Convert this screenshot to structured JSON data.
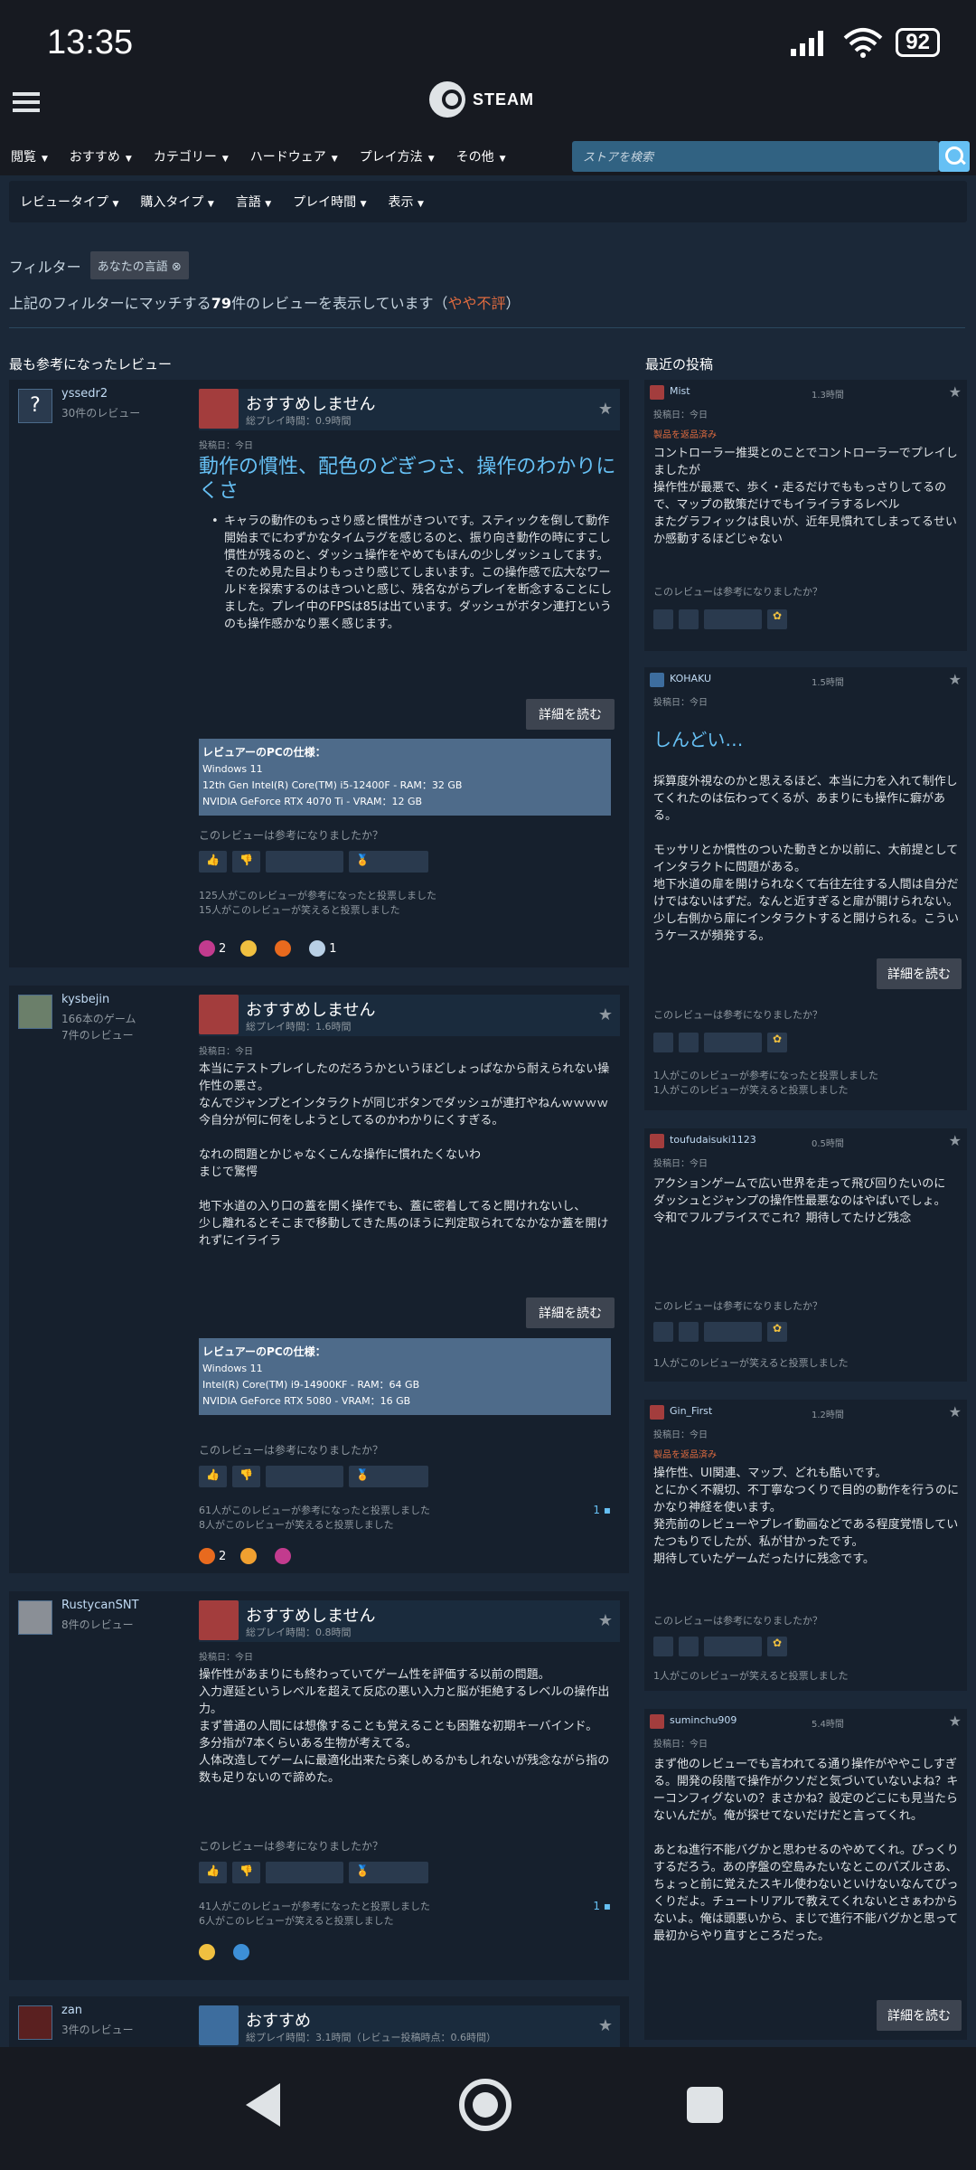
{
  "status": {
    "time": "13:35",
    "battery": "92"
  },
  "header": {
    "logo_text": "STEAM"
  },
  "nav": {
    "items": [
      "閲覧",
      "おすすめ",
      "カテゴリー",
      "ハードウェア",
      "プレイ方法",
      "その他"
    ],
    "search_placeholder": "ストアを検索"
  },
  "subnav": {
    "items": [
      "レビュータイプ",
      "購入タイプ",
      "言語",
      "プレイ時間",
      "表示"
    ]
  },
  "filter": {
    "label": "フィルター",
    "tag": "あなたの言語",
    "match_prefix": "上記のフィルターにマッチする",
    "match_count": "79",
    "match_suffix": "件のレビューを表示しています（",
    "rating": "やや不評",
    "match_close": "）"
  },
  "sections": {
    "helpful_title": "最も参考になったレビュー",
    "recent_title": "最近の投稿"
  },
  "common": {
    "not_recommended": "おすすめしません",
    "recommended": "おすすめ",
    "read_more": "詳細を読む",
    "helpful_q": "このレビューは参考になりましたか？",
    "pc_specs_title": "レビュアーのPCの仕様："
  },
  "reviews": [
    {
      "user": "yssedr2",
      "games": "",
      "count": "30件のレビュー",
      "hours": "総プレイ時間：0.9時間",
      "date": "投稿日：今日",
      "title": "動作の慣性、配色のどぎつさ、操作のわかりにくさ",
      "text": "キャラの動作のもっさり感と慣性がきついです。スティックを倒して動作開始までにわずかなタイムラグを感じるのと、振り向き動作の時にすこし慣性が残るのと、ダッシュ操作をやめてもほんの少しダッシュしてます。そのため見た目よりもっさり感じてしまいます。この操作感で広大なワールドを探索するのはきついと感じ、残名ながらプレイを断念することにしました。プレイ中のFPSは85は出ています。ダッシュがボタン連打というのも操作感かなり悪く感じます。",
      "specs": [
        "Windows 11",
        "12th Gen Intel(R) Core(TM) i5-12400F - RAM：32 GB",
        "NVIDIA GeForce RTX 4070 Ti - VRAM：12 GB"
      ],
      "stats": [
        "125人がこのレビューが参考になったと投票しました",
        "15人がこのレビューが笑えると投票しました"
      ],
      "awards": [
        "2",
        "",
        "",
        "1"
      ],
      "comments": ""
    },
    {
      "user": "kysbejin",
      "games": "166本のゲーム",
      "count": "7件のレビュー",
      "hours": "総プレイ時間：1.6時間",
      "date": "投稿日：今日",
      "title": "",
      "text": "本当にテストプレイしたのだろうかというほどしょっぱなから耐えられない操作性の悪さ。\nなんでジャンプとインタラクトが同じボタンでダッシュが連打やねんｗｗｗｗ\n今自分が何に何をしようとしてるのかわかりにくすぎる。\n\nなれの問題とかじゃなくこんな操作に慣れたくないわ\nまじで驚愕\n\n地下水道の入り口の蓋を開く操作でも、蓋に密着してると開けれないし、\n少し離れるとそこまで移動してきた馬のほうに判定取られてなかなか蓋を開けれずにイライラ",
      "specs": [
        "Windows 11",
        "Intel(R) Core(TM) i9-14900KF - RAM：64 GB",
        "NVIDIA GeForce RTX 5080 - VRAM：16 GB"
      ],
      "stats": [
        "61人がこのレビューが参考になったと投票しました",
        "8人がこのレビューが笑えると投票しました"
      ],
      "awards": [
        "2",
        "",
        ""
      ],
      "comments": "1"
    },
    {
      "user": "RustycanSNT",
      "games": "",
      "count": "8件のレビュー",
      "hours": "総プレイ時間：0.8時間",
      "date": "投稿日：今日",
      "title": "",
      "text": "操作性があまりにも終わっていてゲーム性を評価する以前の問題。\n入力遅延というレベルを超えて反応の悪い入力と脳が拒絶するレベルの操作出力。\nまず普通の人間には想像することも覚えることも困難な初期キーバインド。\n多分指が7本くらいある生物が考えてる。\n人体改造してゲームに最適化出来たら楽しめるかもしれないが残念ながら指の数も足りないので諦めた。",
      "specs": [],
      "stats": [
        "41人がこのレビューが参考になったと投票しました",
        "6人がこのレビューが笑えると投票しました"
      ],
      "awards": [
        "",
        ""
      ],
      "comments": "1"
    },
    {
      "user": "zan",
      "games": "",
      "count": "3件のレビュー",
      "hours": "総プレイ時間：3.1時間（レビュー投稿時点：0.6時間）",
      "date": "",
      "title": "",
      "text": "",
      "specs": [],
      "stats": [],
      "awards": [],
      "comments": ""
    }
  ],
  "recent": [
    {
      "user": "Mist",
      "hours": "1.3時間",
      "date": "投稿日：今日",
      "refund": "製品を返品済み",
      "title": "",
      "text": "コントローラー推奨とのことでコントローラーでプレイしましたが\n操作性が最悪で、歩く・走るだけでももっさりしてるので、マップの散策だけでもイライラするレベル\nまたグラフィックは良いが、近年見慣れてしまってるせいか感動するほどじゃない",
      "stats": []
    },
    {
      "user": "KOHAKU",
      "hours": "1.5時間",
      "date": "投稿日：今日",
      "refund": "",
      "title": "しんどい…",
      "text": "採算度外視なのかと思えるほど、本当に力を入れて制作してくれたのは伝わってくるが、あまりにも操作に癖がある。\n\nモッサリとか慣性のついた動きとか以前に、大前提としてインタラクトに問題がある。\n地下水道の扉を開けられなくて右往左往する人間は自分だけではないはずだ。なんと近すぎると扉が開けられない。少し右側から扉にインタラクトすると開けられる。こういうケースが頻発する。",
      "stats": [
        "1人がこのレビューが参考になったと投票しました",
        "1人がこのレビューが笑えると投票しました"
      ]
    },
    {
      "user": "toufudaisuki1123",
      "hours": "0.5時間",
      "date": "投稿日：今日",
      "refund": "",
      "title": "",
      "text": "アクションゲームで広い世界を走って飛び回りたいのに\nダッシュとジャンプの操作性最悪なのはやばいでしょ。\n令和でフルプライスでこれ？期待してたけど残念",
      "stats": [
        "1人がこのレビューが笑えると投票しました"
      ]
    },
    {
      "user": "Gin_First",
      "hours": "1.2時間",
      "date": "投稿日：今日",
      "refund": "製品を返品済み",
      "title": "",
      "text": "操作性、UI関連、マップ、どれも酷いです。\nとにかく不親切、不丁寧なつくりで目的の動作を行うのにかなり神経を使います。\n発売前のレビューやプレイ動画などである程度覚悟していたつもりでしたが、私が甘かったです。\n期待していたゲームだったけに残念です。",
      "stats": [
        "1人がこのレビューが笑えると投票しました"
      ]
    },
    {
      "user": "suminchu909",
      "hours": "5.4時間",
      "date": "投稿日：今日",
      "refund": "",
      "title": "",
      "text": "まず他のレビューでも言われてる通り操作がややこしすぎる。開発の段階で操作がクソだと気づいていないよね？キーコンフィグないの？まさかね？設定のどこにも見当たらないんだが。俺が探せてないだけだと言ってくれ。\n\nあとね進行不能バグかと思わせるのやめてくれ。ぴっくりするだろう。あの序盤の空島みたいなとこのパズルさあ、ちょっと前に覚えたスキル使わないといけないなんてびっくりだよ。チュートリアルで教えてくれないとさぁわからないよ。俺は頭悪いから、まじで進行不能バグかと思って最初からやり直すところだった。",
      "stats": []
    }
  ]
}
